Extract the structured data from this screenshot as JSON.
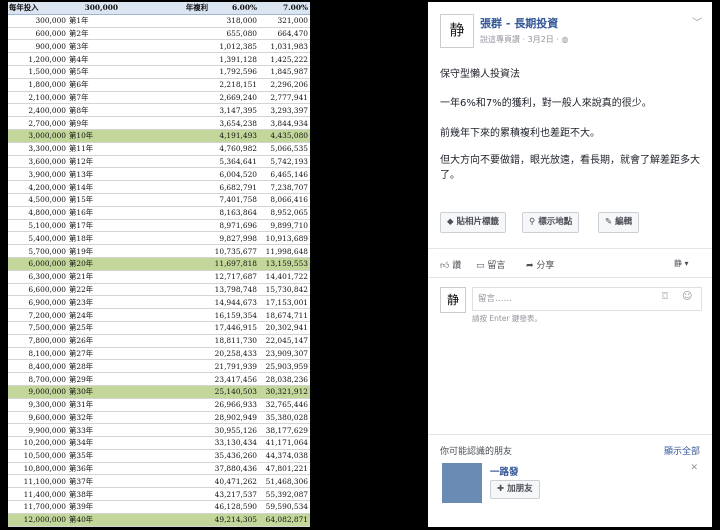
{
  "sheet": {
    "header": [
      "每年投入",
      "300,000",
      "",
      "年複利",
      "6.00%",
      "7.00%"
    ],
    "rows": [
      [
        "300,000",
        "第1年",
        "318,000",
        "321,000"
      ],
      [
        "600,000",
        "第2年",
        "655,080",
        "664,470"
      ],
      [
        "900,000",
        "第3年",
        "1,012,385",
        "1,031,983"
      ],
      [
        "1,200,000",
        "第4年",
        "1,391,128",
        "1,425,222"
      ],
      [
        "1,500,000",
        "第5年",
        "1,792,596",
        "1,845,987"
      ],
      [
        "1,800,000",
        "第6年",
        "2,218,151",
        "2,296,206"
      ],
      [
        "2,100,000",
        "第7年",
        "2,669,240",
        "2,777,941"
      ],
      [
        "2,400,000",
        "第8年",
        "3,147,395",
        "3,293,397"
      ],
      [
        "2,700,000",
        "第9年",
        "3,654,238",
        "3,844,934"
      ],
      [
        "3,000,000",
        "第10年",
        "4,191,493",
        "4,435,080"
      ],
      [
        "3,300,000",
        "第11年",
        "4,760,982",
        "5,066,535"
      ],
      [
        "3,600,000",
        "第12年",
        "5,364,641",
        "5,742,193"
      ],
      [
        "3,900,000",
        "第13年",
        "6,004,520",
        "6,465,146"
      ],
      [
        "4,200,000",
        "第14年",
        "6,682,791",
        "7,238,707"
      ],
      [
        "4,500,000",
        "第15年",
        "7,401,758",
        "8,066,416"
      ],
      [
        "4,800,000",
        "第16年",
        "8,163,864",
        "8,952,065"
      ],
      [
        "5,100,000",
        "第17年",
        "8,971,696",
        "9,899,710"
      ],
      [
        "5,400,000",
        "第18年",
        "9,827,998",
        "10,913,689"
      ],
      [
        "5,700,000",
        "第19年",
        "10,735,677",
        "11,998,648"
      ],
      [
        "6,000,000",
        "第20年",
        "11,697,818",
        "13,159,553"
      ],
      [
        "6,300,000",
        "第21年",
        "12,717,687",
        "14,401,722"
      ],
      [
        "6,600,000",
        "第22年",
        "13,798,748",
        "15,730,842"
      ],
      [
        "6,900,000",
        "第23年",
        "14,944,673",
        "17,153,001"
      ],
      [
        "7,200,000",
        "第24年",
        "16,159,354",
        "18,674,711"
      ],
      [
        "7,500,000",
        "第25年",
        "17,446,915",
        "20,302,941"
      ],
      [
        "7,800,000",
        "第26年",
        "18,811,730",
        "22,045,147"
      ],
      [
        "8,100,000",
        "第27年",
        "20,258,433",
        "23,909,307"
      ],
      [
        "8,400,000",
        "第28年",
        "21,791,939",
        "25,903,959"
      ],
      [
        "8,700,000",
        "第29年",
        "23,417,456",
        "28,038,236"
      ],
      [
        "9,000,000",
        "第30年",
        "25,140,503",
        "30,321,912"
      ],
      [
        "9,300,000",
        "第31年",
        "26,966,933",
        "32,765,446"
      ],
      [
        "9,600,000",
        "第32年",
        "28,902,949",
        "35,380,028"
      ],
      [
        "9,900,000",
        "第33年",
        "30,955,126",
        "38,177,629"
      ],
      [
        "10,200,000",
        "第34年",
        "33,130,434",
        "41,171,064"
      ],
      [
        "10,500,000",
        "第35年",
        "35,436,260",
        "44,374,038"
      ],
      [
        "10,800,000",
        "第36年",
        "37,880,436",
        "47,801,221"
      ],
      [
        "11,100,000",
        "第37年",
        "40,471,262",
        "51,468,306"
      ],
      [
        "11,400,000",
        "第38年",
        "43,217,537",
        "55,392,087"
      ],
      [
        "11,700,000",
        "第39年",
        "46,128,590",
        "59,590,534"
      ],
      [
        "12,000,000",
        "第40年",
        "49,214,305",
        "64,082,871"
      ]
    ],
    "highlight_rows": [
      9,
      19,
      29,
      39
    ],
    "highlight_color": "#c4d79b",
    "header_color": "#dbe5f1"
  },
  "post": {
    "avatar_text": "静",
    "author": "張群 - 長期投資",
    "subtitle": "說這專頁讚 · 3月2日 ·",
    "paragraphs": [
      "保守型懶人投資法",
      "一年6%和7%的獲利，對一般人來說真的很少。",
      "前幾年下來的累積複利也差距不大。",
      "但大方向不要做錯，眼光放遠，看長期，就會了解差距多大了。"
    ],
    "tag_buttons": [
      "貼相片標籤",
      "標示地點",
      "編輯"
    ],
    "actions": {
      "like": "讚",
      "comment": "留言",
      "share": "分享"
    },
    "comment_placeholder": "留言……",
    "comment_hint": "請按 Enter 鍵發表。",
    "pymk_title": "你可能認識的朋友",
    "show_all": "顯示全部",
    "friend_name": "一路發",
    "add_friend": "加朋友",
    "link_color": "#365899"
  }
}
